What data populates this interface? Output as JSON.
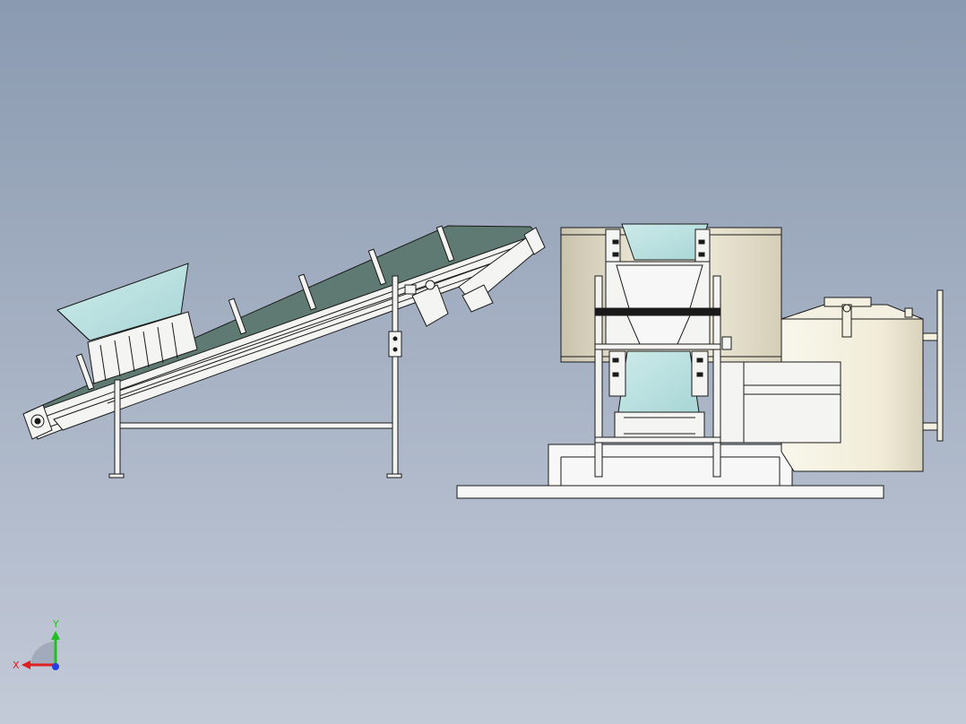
{
  "triad": {
    "x_label": "X",
    "y_label": "Y",
    "x_color": "#e02020",
    "y_color": "#20c020",
    "z_color": "#2040e0"
  },
  "colors": {
    "background_top": "#8a9ab0",
    "background_bottom": "#c3cad8",
    "line": "#1a1a1a",
    "hopper_fill": "#bfe3e3",
    "belt_fill": "#5e7a72",
    "frame_fill": "#f4f4f2",
    "drum_fill": "#f2edd8",
    "tank_fill": "#f6f3e4",
    "base_fill": "#f7f7f7"
  }
}
